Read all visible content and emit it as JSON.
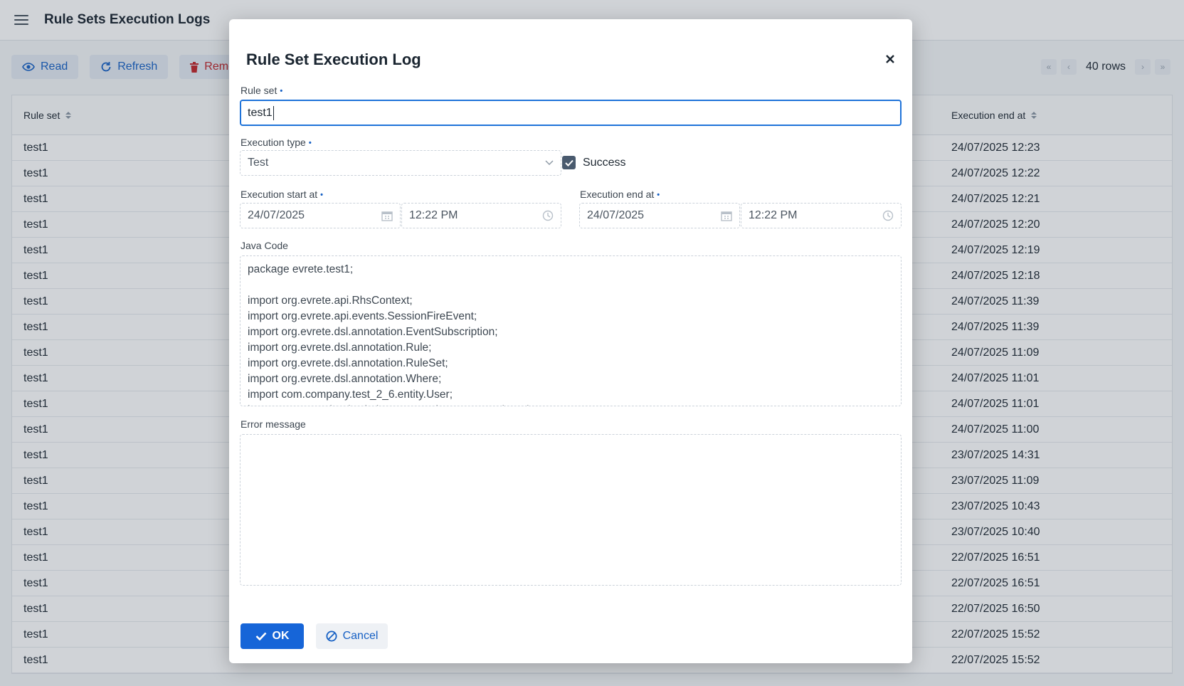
{
  "app": {
    "title": "Rule Sets Execution Logs"
  },
  "toolbar": {
    "read_label": "Read",
    "refresh_label": "Refresh",
    "remove_label": "Remo",
    "rows_label": "40 rows"
  },
  "grid": {
    "columns": {
      "rule_set": "Rule set",
      "execution_end_at": "Execution end at"
    },
    "rows": [
      {
        "rule_set": "test1",
        "end_at": "24/07/2025 12:23"
      },
      {
        "rule_set": "test1",
        "end_at": "24/07/2025 12:22"
      },
      {
        "rule_set": "test1",
        "end_at": "24/07/2025 12:21"
      },
      {
        "rule_set": "test1",
        "end_at": "24/07/2025 12:20"
      },
      {
        "rule_set": "test1",
        "end_at": "24/07/2025 12:19"
      },
      {
        "rule_set": "test1",
        "end_at": "24/07/2025 12:18"
      },
      {
        "rule_set": "test1",
        "end_at": "24/07/2025 11:39"
      },
      {
        "rule_set": "test1",
        "end_at": "24/07/2025 11:39"
      },
      {
        "rule_set": "test1",
        "end_at": "24/07/2025 11:09"
      },
      {
        "rule_set": "test1",
        "end_at": "24/07/2025 11:01"
      },
      {
        "rule_set": "test1",
        "end_at": "24/07/2025 11:01"
      },
      {
        "rule_set": "test1",
        "end_at": "24/07/2025 11:00"
      },
      {
        "rule_set": "test1",
        "end_at": "23/07/2025 14:31"
      },
      {
        "rule_set": "test1",
        "end_at": "23/07/2025 11:09"
      },
      {
        "rule_set": "test1",
        "end_at": "23/07/2025 10:43"
      },
      {
        "rule_set": "test1",
        "end_at": "23/07/2025 10:40"
      },
      {
        "rule_set": "test1",
        "end_at": "22/07/2025 16:51"
      },
      {
        "rule_set": "test1",
        "end_at": "22/07/2025 16:51"
      },
      {
        "rule_set": "test1",
        "end_at": "22/07/2025 16:50"
      },
      {
        "rule_set": "test1",
        "end_at": "22/07/2025 15:52"
      },
      {
        "rule_set": "test1",
        "end_at": "22/07/2025 15:52"
      }
    ]
  },
  "dialog": {
    "title": "Rule Set Execution Log",
    "close_symbol": "×",
    "rule_set_label": "Rule set",
    "rule_set_value": "test1",
    "execution_type_label": "Execution type",
    "execution_type_value": "Test",
    "success_label": "Success",
    "success_checked": true,
    "start_label": "Execution start at",
    "start_date": "24/07/2025",
    "start_time": "12:22 PM",
    "end_label": "Execution end at",
    "end_date": "24/07/2025",
    "end_time": "12:22 PM",
    "java_code_label": "Java Code",
    "java_code": "package evrete.test1;\n\nimport org.evrete.api.RhsContext;\nimport org.evrete.api.events.SessionFireEvent;\nimport org.evrete.dsl.annotation.EventSubscription;\nimport org.evrete.dsl.annotation.Rule;\nimport org.evrete.dsl.annotation.RuleSet;\nimport org.evrete.dsl.annotation.Where;\nimport com.company.test_2_6.entity.User;\nimport gr.netmechanics.jmix.evrete.action.LoggerRuleAction;",
    "error_message_label": "Error message",
    "error_message": "",
    "ok_label": "OK",
    "cancel_label": "Cancel"
  },
  "colors": {
    "primary": "#1665d8",
    "focus_border": "#1f73d9",
    "danger": "#c0252a",
    "checkbox": "#495a6e"
  }
}
